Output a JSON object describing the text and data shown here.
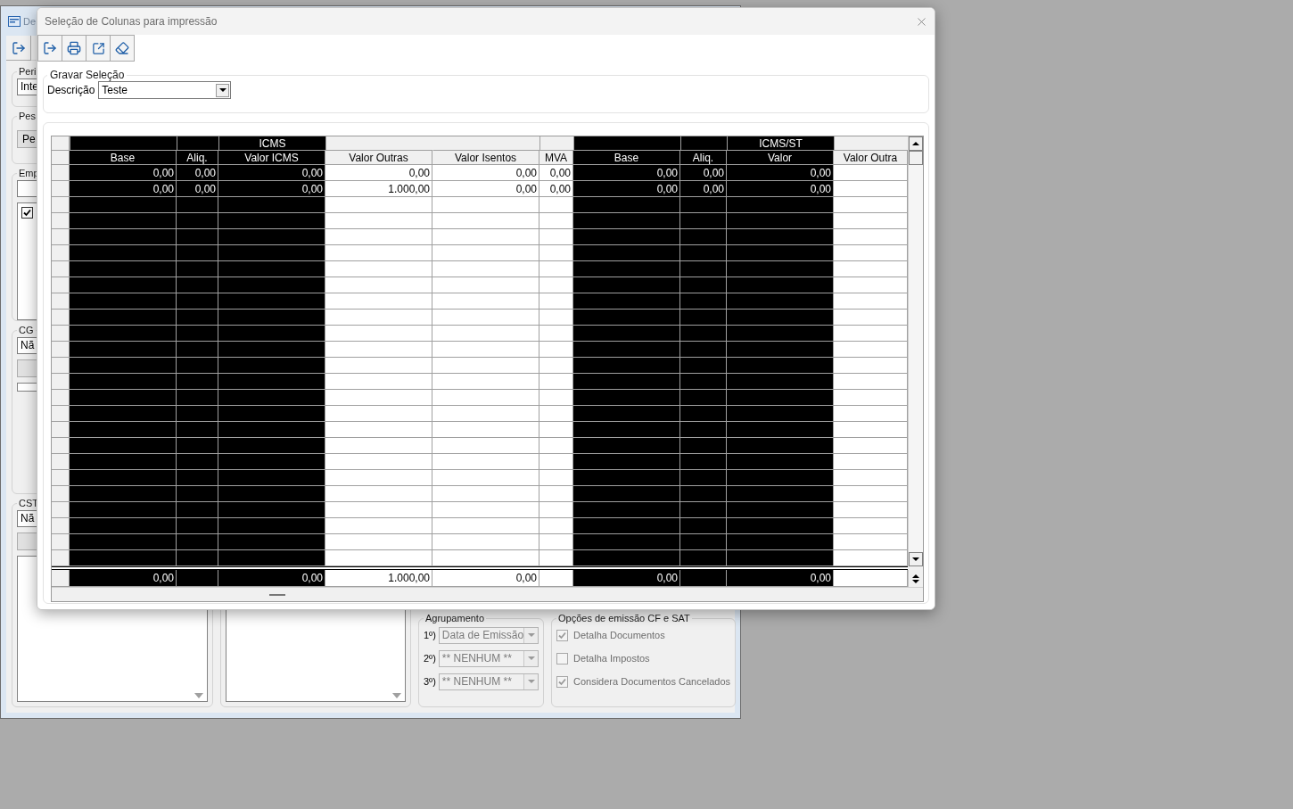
{
  "background_window": {
    "title": "De",
    "left_panel": {
      "period": {
        "legend": "Peri",
        "value": "Inte"
      },
      "search": {
        "legend": "Pes",
        "button": "Pe"
      },
      "company": {
        "legend": "Emp",
        "items": [
          {
            "checked": true
          }
        ]
      },
      "cgc": {
        "legend": "CG",
        "value": "Nã"
      },
      "cst": {
        "legend": "CST",
        "value": "Nã"
      }
    },
    "grouping": {
      "legend": "Agrupamento",
      "levels": [
        {
          "label": "1º)",
          "value": "Data de Emissão",
          "disabled": true
        },
        {
          "label": "2º)",
          "value": "** NENHUM **",
          "disabled": true
        },
        {
          "label": "3º)",
          "value": "** NENHUM **",
          "disabled": true
        }
      ]
    },
    "options": {
      "legend": "Opções de emissão CF e SAT",
      "items": [
        {
          "label": "Detalha Documentos",
          "checked": true,
          "disabled": true
        },
        {
          "label": "Detalha Impostos",
          "checked": false,
          "disabled": true
        },
        {
          "label": "Considera Documentos Cancelados",
          "checked": true,
          "disabled": true
        }
      ]
    }
  },
  "dialog": {
    "title": "Seleção de Colunas para impressão",
    "save_selection": {
      "legend": "Gravar Seleção",
      "label": "Descrição",
      "value": "Teste"
    },
    "grid": {
      "columns": [
        {
          "header": "Base",
          "selected": true,
          "band_continues": false,
          "values": [
            "0,00",
            "0,00"
          ],
          "total": "0,00"
        },
        {
          "header": "Aliq.",
          "selected": true,
          "band_continues": false,
          "values": [
            "0,00",
            "0,00"
          ]
        },
        {
          "header": "Valor ICMS",
          "band": "ICMS",
          "selected": true,
          "band_continues": false,
          "values": [
            "0,00",
            "0,00"
          ],
          "total": "0,00"
        },
        {
          "header": "Valor Outras",
          "selected": false,
          "band_continues": false,
          "values": [
            "0,00",
            "1.000,00"
          ],
          "total": "1.000,00"
        },
        {
          "header": "Valor Isentos",
          "selected": false,
          "band_continues": true,
          "values": [
            "0,00",
            "0,00"
          ],
          "total": "0,00"
        },
        {
          "header": "MVA",
          "selected": false,
          "band_continues": false,
          "values": [
            "0,00",
            "0,00"
          ]
        },
        {
          "header": "Base",
          "selected": true,
          "band_continues": false,
          "values": [
            "0,00",
            "0,00"
          ],
          "total": "0,00"
        },
        {
          "header": "Aliq.",
          "selected": true,
          "band_continues": false,
          "values": [
            "0,00",
            "0,00"
          ]
        },
        {
          "header": "Valor",
          "band": "ICMS/ST",
          "selected": true,
          "band_continues": false,
          "values": [
            "0,00",
            "0,00"
          ],
          "total": "0,00"
        },
        {
          "header": "Valor Outra",
          "selected": false,
          "band_continues": false
        }
      ]
    }
  }
}
